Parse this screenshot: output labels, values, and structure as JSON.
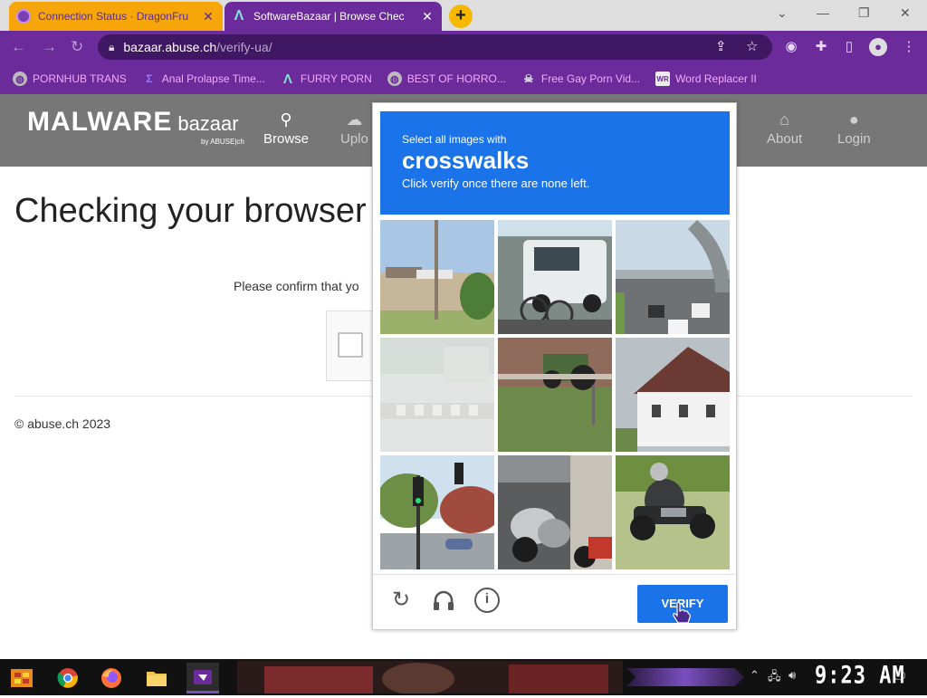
{
  "browser": {
    "tabs": [
      {
        "title": "Connection Status · DragonFru",
        "close": "✕"
      },
      {
        "title": "SoftwareBazaar | Browse Chec",
        "close": "✕",
        "active": true
      }
    ],
    "new_tab": "+",
    "window_controls": [
      "⌄",
      "—",
      "❐",
      "✕"
    ],
    "url_host": "bazaar.abuse.ch",
    "url_path": "/verify-ua/",
    "bookmarks": [
      {
        "icon": "globe-icon",
        "label": "PORNHUB TRANS"
      },
      {
        "icon": "sigma-icon",
        "label": "Anal Prolapse Time..."
      },
      {
        "icon": "lambda-icon",
        "label": "FURRY PORN"
      },
      {
        "icon": "globe-icon",
        "label": "BEST OF HORRO..."
      },
      {
        "icon": "skull-icon",
        "label": "Free Gay Porn Vid..."
      },
      {
        "icon": "wr-icon",
        "label": "Word Replacer II"
      }
    ],
    "accent": "#6b2b9a"
  },
  "site": {
    "logo_main": "MALWARE",
    "logo_sub": "bazaar",
    "logo_by": "by ABUSE|ch",
    "nav": [
      {
        "icon": "search-icon",
        "label": "Browse"
      },
      {
        "icon": "upload-icon",
        "label": "Uplo"
      },
      {
        "icon": "bank-icon",
        "label": "About"
      },
      {
        "icon": "user-icon",
        "label": "Login"
      }
    ],
    "heading": "Checking your browser",
    "confirm_text": "Please confirm that yo",
    "footer": "© abuse.ch 2023"
  },
  "captcha": {
    "line1": "Select all images with",
    "target": "crosswalks",
    "line3": "Click verify once there are none left.",
    "tiles": [
      "field-with-pole",
      "car-and-bicycle",
      "highway-traffic",
      "faded-crosswalk",
      "tractor-field",
      "white-house",
      "traffic-light-street",
      "parked-scooters",
      "motorcycle-rider"
    ],
    "verify_label": "VERIFY",
    "header_color": "#1a73e8"
  },
  "taskbar": {
    "clock": "9:23 AM",
    "apps": [
      "start-icon",
      "chrome-icon",
      "firefox-icon",
      "folder-icon",
      "app-icon"
    ]
  }
}
